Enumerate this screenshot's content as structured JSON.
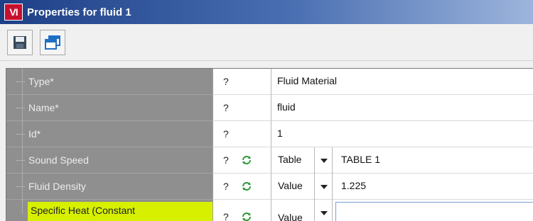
{
  "window": {
    "app_icon_text": "VI",
    "title": "Properties for fluid 1"
  },
  "toolbar": {
    "buttons": [
      {
        "icon": "save-icon"
      },
      {
        "icon": "windows-icon"
      }
    ]
  },
  "properties": [
    {
      "name": "Type*",
      "help": "?",
      "refresh": false,
      "value": "Fluid Material"
    },
    {
      "name": "Name*",
      "help": "?",
      "refresh": false,
      "value": "fluid"
    },
    {
      "name": "Id*",
      "help": "?",
      "refresh": false,
      "value": "1"
    },
    {
      "name": "Sound Speed",
      "help": "?",
      "refresh": true,
      "combo": "Table",
      "value": "TABLE 1"
    },
    {
      "name": "Fluid Density",
      "help": "?",
      "refresh": true,
      "combo": "Value",
      "value": "1.225"
    },
    {
      "name": "Specific Heat (Constant",
      "help": "?",
      "refresh": true,
      "combo": "Value",
      "value": "",
      "highlighted": true
    }
  ],
  "colors": {
    "title_gradient_start": "#1d3f86",
    "name_column_bg": "#8f8f8f",
    "highlight": "#d6f000",
    "refresh_icon": "#2e9a3c"
  }
}
